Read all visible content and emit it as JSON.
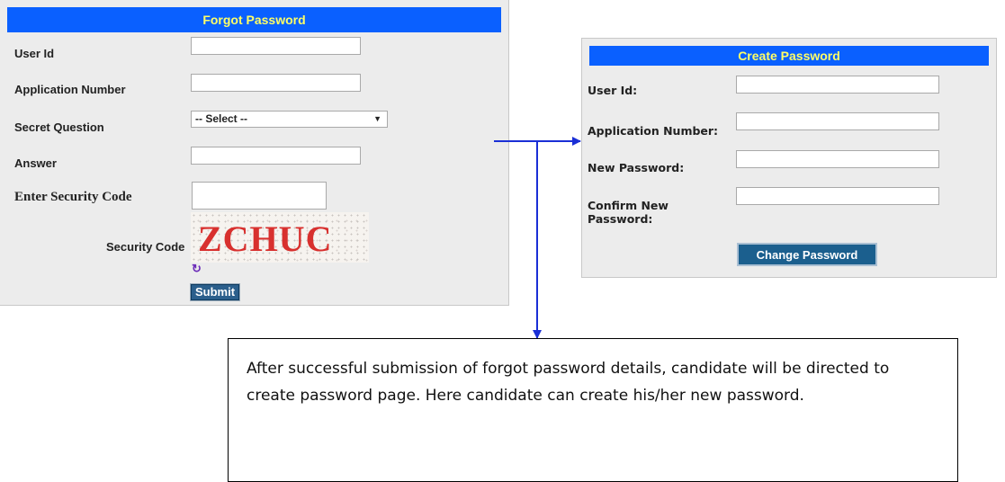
{
  "forgot_password": {
    "title": "Forgot Password",
    "labels": {
      "user_id": "User Id",
      "application_number": "Application Number",
      "secret_question": "Secret Question",
      "answer": "Answer",
      "enter_security_code": "Enter Security Code",
      "security_code": "Security Code"
    },
    "secret_question_value": "-- Select --",
    "captcha_text": "ZCHUC",
    "submit_label": "Submit"
  },
  "create_password": {
    "title": "Create Password",
    "labels": {
      "user_id": "User Id:",
      "application_number": "Application Number:",
      "new_password": "New Password:",
      "confirm_new_password_line1": "Confirm New",
      "confirm_new_password_line2": "Password:"
    },
    "change_password_label": "Change Password"
  },
  "note": {
    "text": "After successful submission of forgot password details, candidate will be directed to create password page. Here candidate can create his/her new password."
  },
  "colors": {
    "header_bar": "#0a60ff",
    "header_text": "#ffff66",
    "arrow": "#1a2fd6",
    "captcha_text": "#d8302e"
  }
}
